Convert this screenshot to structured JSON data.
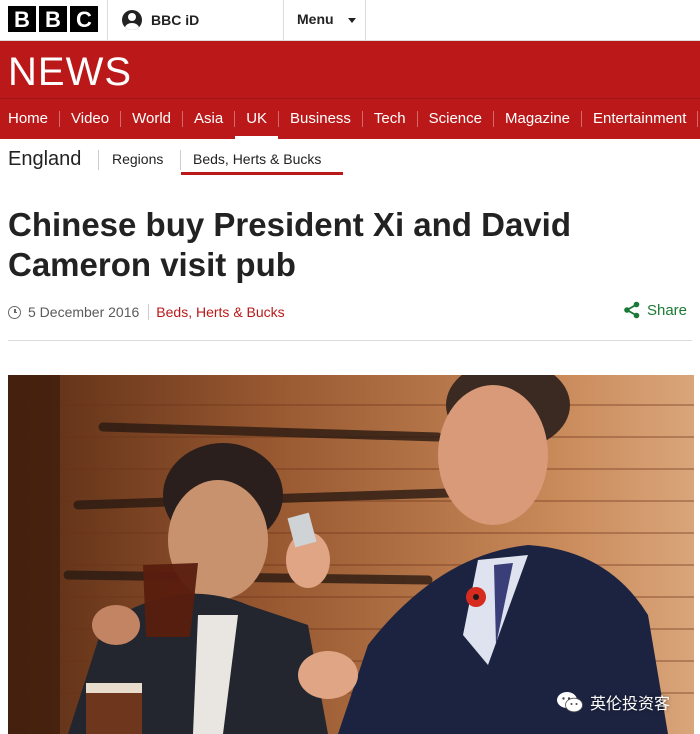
{
  "header": {
    "logo_letters": [
      "B",
      "B",
      "C"
    ],
    "account_label": "BBC iD",
    "menu_label": "Menu"
  },
  "banner": {
    "title": "NEWS"
  },
  "nav": {
    "items": [
      {
        "label": "Home",
        "active": false
      },
      {
        "label": "Video",
        "active": false
      },
      {
        "label": "World",
        "active": false
      },
      {
        "label": "Asia",
        "active": false
      },
      {
        "label": "UK",
        "active": true
      },
      {
        "label": "Business",
        "active": false
      },
      {
        "label": "Tech",
        "active": false
      },
      {
        "label": "Science",
        "active": false
      },
      {
        "label": "Magazine",
        "active": false
      },
      {
        "label": "Entertainment",
        "active": false
      }
    ]
  },
  "subnav": {
    "region": "England",
    "regions_link": "Regions",
    "current": "Beds, Herts & Bucks"
  },
  "article": {
    "headline": "Chinese buy President Xi and David Cameron visit pub",
    "date": "5 December 2016",
    "section": "Beds, Herts & Bucks",
    "share_label": "Share"
  },
  "watermark": {
    "text": "英伦投资客",
    "icon": "wechat-icon"
  },
  "colors": {
    "brand_red": "#bb1919",
    "share_green": "#1a7a35"
  }
}
